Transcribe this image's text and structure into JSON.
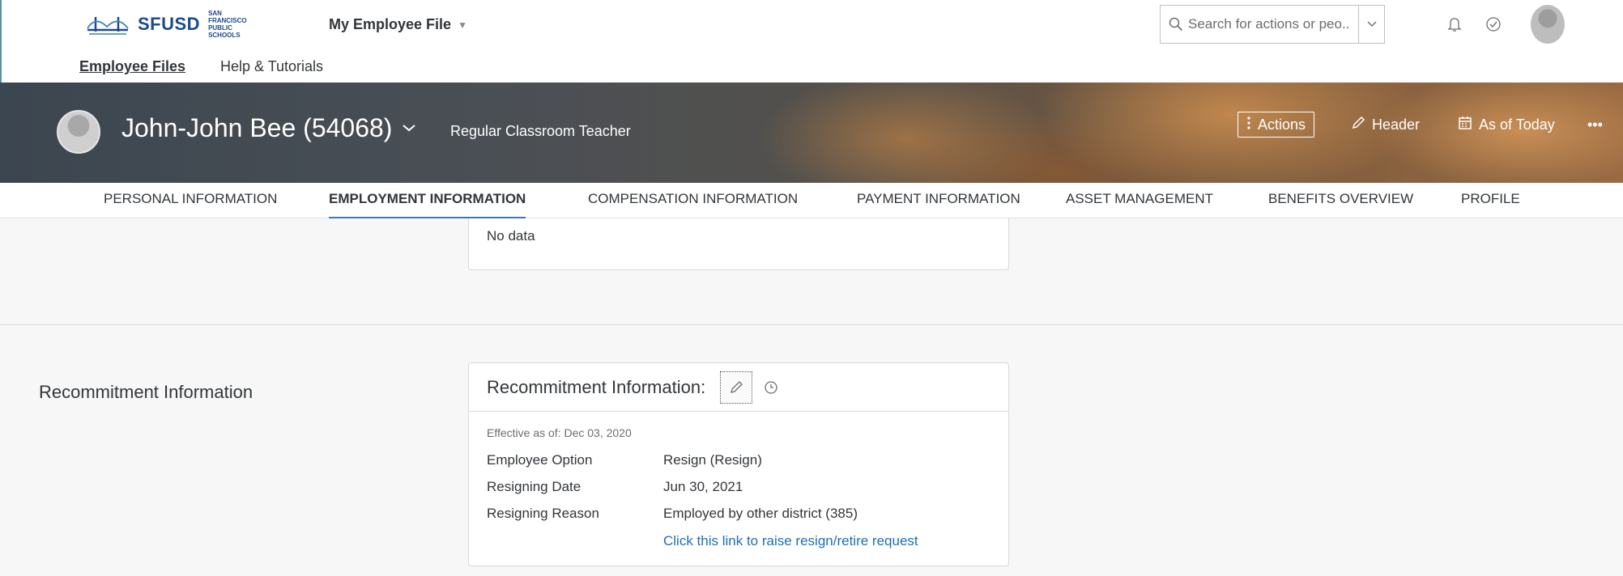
{
  "shell": {
    "logo_text": "SFUSD",
    "logo_subtext": "SAN FRANCISCO PUBLIC SCHOOLS",
    "app_title": "My Employee File",
    "search_placeholder": "Search for actions or peo..."
  },
  "subnav": {
    "items": [
      {
        "label": "Employee Files",
        "active": true
      },
      {
        "label": "Help & Tutorials",
        "active": false
      }
    ]
  },
  "header": {
    "employee_name": "John-John Bee (54068)",
    "job_title": "Regular Classroom Teacher",
    "actions_label": "Actions",
    "header_label": "Header",
    "as_of_label": "As of Today",
    "more_label": "•••"
  },
  "tabs": [
    {
      "label": "PERSONAL INFORMATION",
      "active": false
    },
    {
      "label": "EMPLOYMENT INFORMATION",
      "active": true
    },
    {
      "label": "COMPENSATION INFORMATION",
      "active": false
    },
    {
      "label": "PAYMENT INFORMATION",
      "active": false
    },
    {
      "label": "ASSET MANAGEMENT",
      "active": false
    },
    {
      "label": "BENEFITS OVERVIEW",
      "active": false
    },
    {
      "label": "PROFILE",
      "active": false
    }
  ],
  "previous_card": {
    "text": "No data"
  },
  "recommitment": {
    "section_label": "Recommitment Information",
    "card_title": "Recommitment Information:",
    "effective": "Effective as of: Dec 03, 2020",
    "rows": [
      {
        "label": "Employee Option",
        "value": "Resign (Resign)"
      },
      {
        "label": "Resigning Date",
        "value": "Jun 30, 2021"
      },
      {
        "label": "Resigning Reason",
        "value": "Employed by other district (385)"
      }
    ],
    "link_text": "Click this link to raise resign/retire request"
  },
  "colors": {
    "accent": "#3a7ab7",
    "link": "#1d6fb8",
    "logo_blue": "#1c4a8c"
  }
}
